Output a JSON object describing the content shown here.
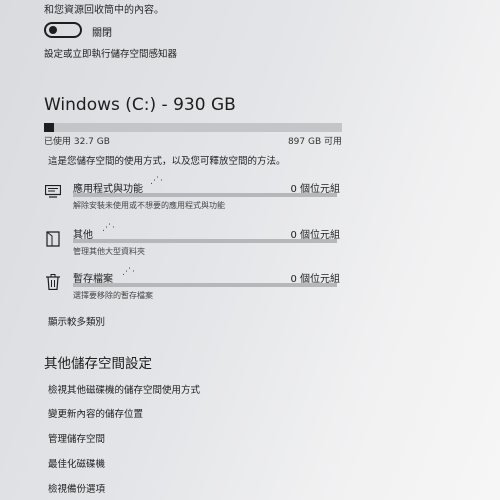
{
  "header": {
    "top_text": "和您資源回收筒中的內容。",
    "toggle_label": "關閉",
    "sense_link": "設定或立即執行儲存空間感知器"
  },
  "drive": {
    "title": "Windows (C:) - 930 GB",
    "used_label": "已使用 32.7 GB",
    "free_label": "897 GB 可用",
    "used_fraction": 0.035,
    "description": "這是您儲存空間的使用方式，以及您可釋放空間的方法。"
  },
  "categories": [
    {
      "icon": "apps-icon",
      "title": "應用程式與功能",
      "size": "0 個位元組",
      "subtitle": "解除安裝未使用或不想要的應用程式與功能"
    },
    {
      "icon": "document-icon",
      "title": "其他",
      "size": "0 個位元組",
      "subtitle": "管理其他大型資料夾"
    },
    {
      "icon": "trash-icon",
      "title": "暫存檔案",
      "size": "0 個位元組",
      "subtitle": "選擇要移除的暫存檔案"
    }
  ],
  "show_more": "顯示較多類別",
  "more_settings": {
    "title": "其他儲存空間設定",
    "links": [
      "檢視其他磁碟機的儲存空間使用方式",
      "變更新內容的儲存位置",
      "管理儲存空間",
      "最佳化磁碟機",
      "檢視備份選項"
    ]
  }
}
